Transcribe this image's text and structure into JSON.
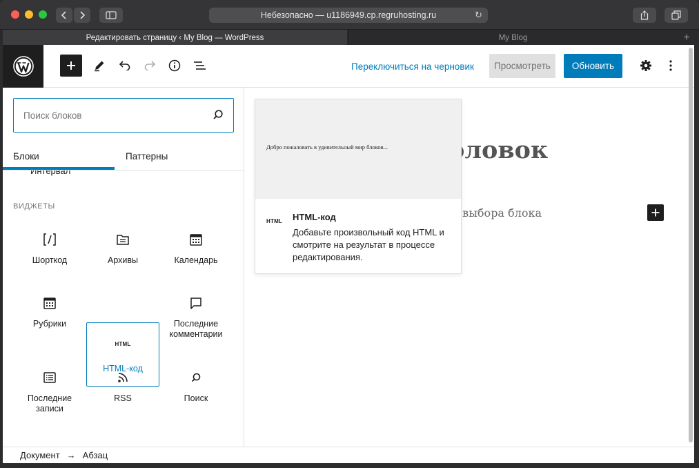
{
  "browser": {
    "address": "Небезопасно — u1186949.cp.regruhosting.ru",
    "tabs": [
      {
        "label": "Редактировать страницу ‹ My Blog — WordPress"
      },
      {
        "label": "My Blog"
      }
    ]
  },
  "header": {
    "switch_to_draft": "Переключиться на черновик",
    "preview": "Просмотреть",
    "update": "Обновить"
  },
  "inserter": {
    "search_placeholder": "Поиск блоков",
    "tab_blocks": "Блоки",
    "tab_patterns": "Паттерны",
    "clipped_label": "Интервал",
    "category": "ВИДЖЕТЫ",
    "blocks": [
      {
        "label": "Шорткод",
        "icon": "shortcode-icon"
      },
      {
        "label": "Архивы",
        "icon": "archive-icon"
      },
      {
        "label": "Календарь",
        "icon": "calendar-icon"
      },
      {
        "label": "Рубрики",
        "icon": "categories-icon"
      },
      {
        "label": "HTML-код",
        "icon": "html-icon",
        "glyph": "HTML"
      },
      {
        "label": "Последние комментарии",
        "icon": "comment-icon"
      },
      {
        "label": "Последние записи",
        "icon": "post-list-icon"
      },
      {
        "label": "RSS",
        "icon": "rss-icon"
      },
      {
        "label": "Поиск",
        "icon": "search-icon"
      }
    ]
  },
  "popover": {
    "preview_text": "Добро пожаловать в удивительный мир блоков...",
    "icon_glyph": "HTML",
    "title": "HTML-код",
    "description": "Добавьте произвольный код HTML и смотрите на результат в процессе редактирования."
  },
  "canvas": {
    "heading_fragment": "оловок",
    "paragraph_fragment": "я выбора блока"
  },
  "footer": {
    "crumb1": "Документ",
    "arrow": "→",
    "crumb2": "Абзац"
  },
  "colors": {
    "accent": "#007cba",
    "toolbar_dark": "#1e1e1e"
  }
}
